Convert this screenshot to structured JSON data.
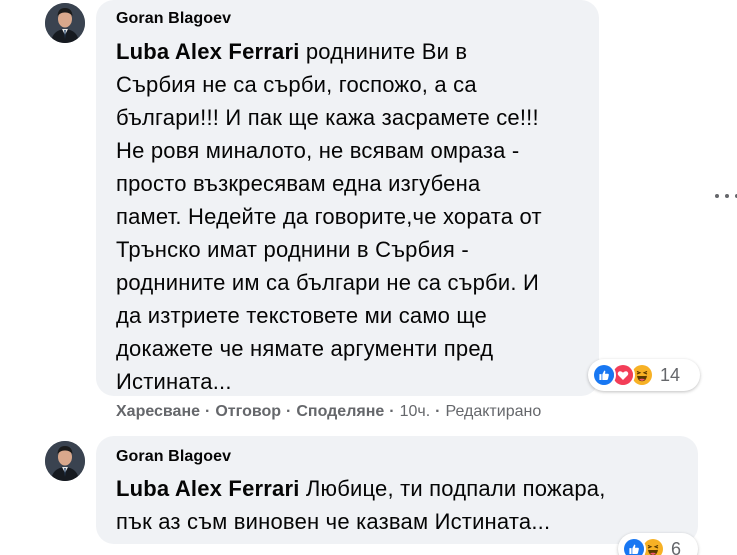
{
  "comments": [
    {
      "author": "Goran Blagoev",
      "tag": "Luba Alex Ferrari",
      "lines": [
        " роднините Ви в",
        "Сърбия не са сърби, госпожо, а са",
        "българи!!! И пак ще кажа засрамете се!!!",
        "Не ровя миналото, не всявам омраза -",
        "просто възкресявам една изгубена",
        "памет. Недейте да говорите,че хората от",
        "Трънско имат роднини в Сърбия -",
        "роднините им са българи не са сърби. И",
        "да изтриете текстовете ми само ще",
        "докажете че нямате аргументи пред",
        "Истината..."
      ],
      "reaction_count": "14",
      "reactions": [
        "like-icon",
        "love-icon",
        "haha-icon"
      ],
      "actions": {
        "like": "Харесване",
        "reply": "Отговор",
        "share": "Споделяне",
        "time": "10ч.",
        "edited": "Редактирано"
      }
    },
    {
      "author": "Goran Blagoev",
      "tag": "Luba Alex Ferrari",
      "lines": [
        " Любице, ти подпали пожара,",
        "пък аз съм виновен че казвам Истината..."
      ],
      "reaction_count": "6",
      "reactions": [
        "like-icon",
        "haha-icon"
      ]
    }
  ],
  "colors": {
    "bubble": "#f0f2f5",
    "secondary_text": "#65676b",
    "like_blue": "#1877f2",
    "love_red": "#f33e58",
    "haha_yellow": "#f7b125"
  }
}
